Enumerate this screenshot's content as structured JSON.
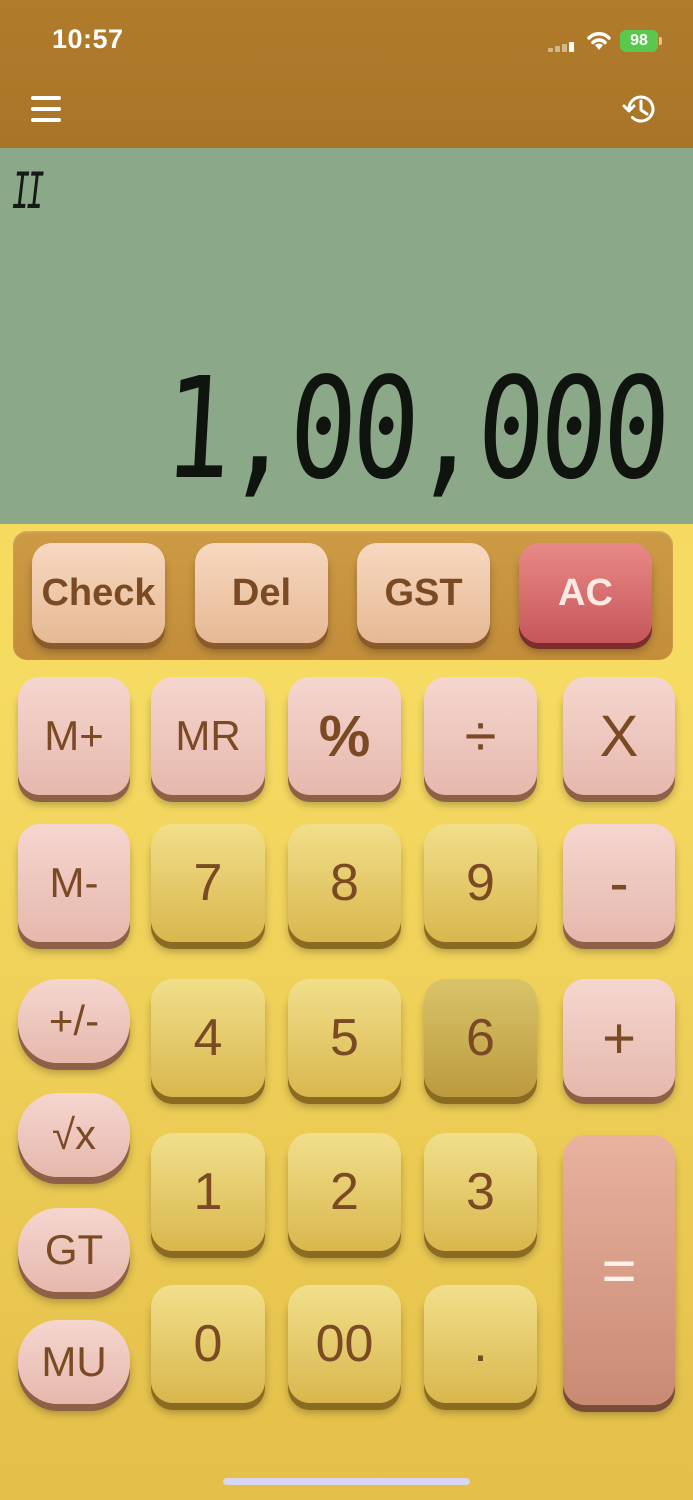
{
  "status_bar": {
    "time": "10:57",
    "battery": "98"
  },
  "header": {
    "menu_icon": "hamburger-menu-icon",
    "history_icon": "history-clock-icon"
  },
  "display": {
    "grand_total_indicator": "II",
    "value": "1,00,000"
  },
  "top_keys": [
    "Check",
    "Del",
    "GST",
    "AC"
  ],
  "keys": {
    "m_plus": "M+",
    "mr": "MR",
    "percent": "%",
    "divide": "÷",
    "multiply": "X",
    "m_minus": "M-",
    "seven": "7",
    "eight": "8",
    "nine": "9",
    "minus": "-",
    "plus_minus": "+/-",
    "four": "4",
    "five": "5",
    "six": "6",
    "plus": "+",
    "sqrt": "√x",
    "one": "1",
    "two": "2",
    "three": "3",
    "equals": "=",
    "gt": "GT",
    "mu": "MU",
    "zero": "0",
    "double_zero": "00",
    "decimal": "."
  },
  "colors": {
    "header": "#a97426",
    "display_bg": "#8ba888",
    "body_bg": "#f6db63",
    "ac_key": "#c7565a",
    "equals_key": "#c98a74"
  }
}
